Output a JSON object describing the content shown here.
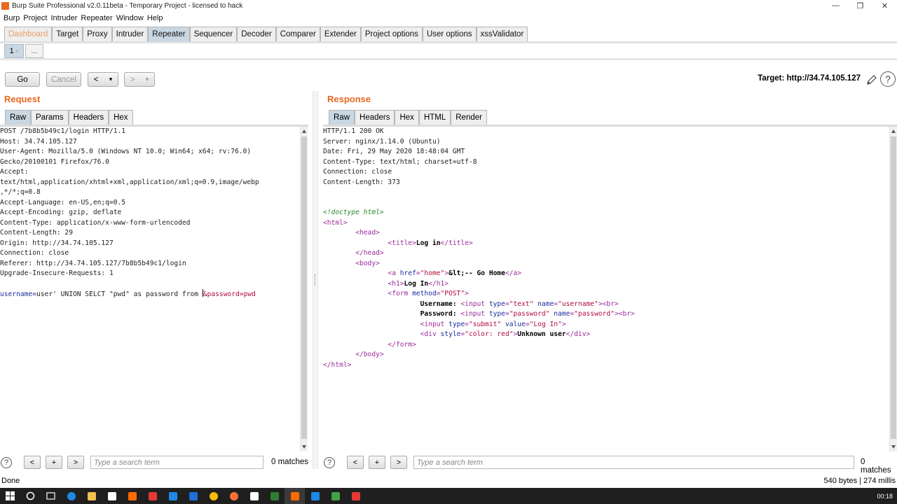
{
  "window": {
    "title": "Burp Suite Professional v2.0.11beta - Temporary Project - licensed to hack",
    "controls": [
      "—",
      "❐",
      "✕"
    ]
  },
  "menu": [
    "Burp",
    "Project",
    "Intruder",
    "Repeater",
    "Window",
    "Help"
  ],
  "main_tabs": [
    "Dashboard",
    "Target",
    "Proxy",
    "Intruder",
    "Repeater",
    "Sequencer",
    "Decoder",
    "Comparer",
    "Extender",
    "Project options",
    "User options",
    "xssValidator"
  ],
  "active_main_tab": "Repeater",
  "sub_tabs": {
    "tab1": "1",
    "tab1_close": "×",
    "add": "..."
  },
  "toolbar": {
    "go": "Go",
    "cancel": "Cancel",
    "back": "<",
    "back_drop": "▾",
    "forward": ">",
    "forward_drop": "▾",
    "target": "Target: http://34.74.105.127"
  },
  "request": {
    "title": "Request",
    "tabs": [
      "Raw",
      "Params",
      "Headers",
      "Hex"
    ],
    "lines": [
      "POST /7b8b5b49c1/login HTTP/1.1",
      "Host: 34.74.105.127",
      "User-Agent: Mozilla/5.0 (Windows NT 10.0; Win64; x64; rv:76.0)",
      "Gecko/20100101 Firefox/76.0",
      "Accept:",
      "text/html,application/xhtml+xml,application/xml;q=0.9,image/webp",
      ",*/*;q=0.8",
      "Accept-Language: en-US,en;q=0.5",
      "Accept-Encoding: gzip, deflate",
      "Content-Type: application/x-www-form-urlencoded",
      "Content-Length: 29",
      "Origin: http://34.74.105.127",
      "Connection: close",
      "Referer: http://34.74.105.127/7b8b5b49c1/login",
      "Upgrade-Insecure-Requests: 1",
      ""
    ],
    "body": {
      "key1": "username",
      "eq1": "=",
      "val1": "user' UNION SELCT \"pwd\" as password from ",
      "amp": "&",
      "key2": "password",
      "eq2": "=",
      "val2": "pwd"
    }
  },
  "response": {
    "title": "Response",
    "tabs": [
      "Raw",
      "Headers",
      "Hex",
      "HTML",
      "Render"
    ],
    "headers": [
      "HTTP/1.1 200 OK",
      "Server: nginx/1.14.0 (Ubuntu)",
      "Date: Fri, 29 May 2020 18:48:04 GMT",
      "Content-Type: text/html; charset=utf-8",
      "Connection: close",
      "Content-Length: 373"
    ],
    "html": {
      "doctype": "<!doctype html>",
      "html_open": "<html>",
      "head_open": "<head>",
      "title_open": "<title>",
      "title_text": "Log in",
      "title_close": "</title>",
      "head_close": "</head>",
      "body_open": "<body>",
      "a_open": "<a ",
      "a_attr": "href",
      "a_val": "\"home\"",
      "a_gt": ">",
      "a_text": "&lt;-- Go Home",
      "a_close": "</a>",
      "h1_open": "<h1>",
      "h1_text": "Log In",
      "h1_close": "</h1>",
      "form_open": "<form ",
      "form_attr": "method",
      "form_val": "\"POST\"",
      "form_gt": ">",
      "user_label": "Username: ",
      "input_open": "<input ",
      "type_attr": "type",
      "text_val": "\"text\"",
      "name_attr": "name",
      "username_val": "\"username\"",
      "br": "><br>",
      "pass_label": "Password: ",
      "password_val": "\"password\"",
      "submit_val": "\"submit\"",
      "value_attr": "value",
      "login_val": "\"Log In\"",
      "gt": ">",
      "div_open": "<div ",
      "style_attr": "style",
      "style_val": "\"color: red\"",
      "div_text": "Unknown user",
      "div_close": "</div>",
      "form_close": "</form>",
      "body_close": "</body>",
      "html_close": "</html>"
    }
  },
  "search": {
    "help": "?",
    "prev": "<",
    "add": "+",
    "next": ">",
    "placeholder": "Type a search term",
    "left_matches": "0 matches",
    "right_matches": "0 matches"
  },
  "status": {
    "left": "Done",
    "right": "540 bytes | 274 millis"
  },
  "taskbar": {
    "clock": "00:18",
    "icon_colors": [
      "#ffffff",
      "#ffffff",
      "#ffffff",
      "#1e88e5",
      "#f0c050",
      "#ffffff",
      "#ff6a00",
      "#e53935",
      "#1e88e5",
      "#1e6fd9",
      "#fbbc05",
      "#ff7139",
      "#ffffff",
      "#2e7d32",
      "#ff6a00",
      "#1e88e5",
      "#43a047",
      "#e53935"
    ]
  }
}
